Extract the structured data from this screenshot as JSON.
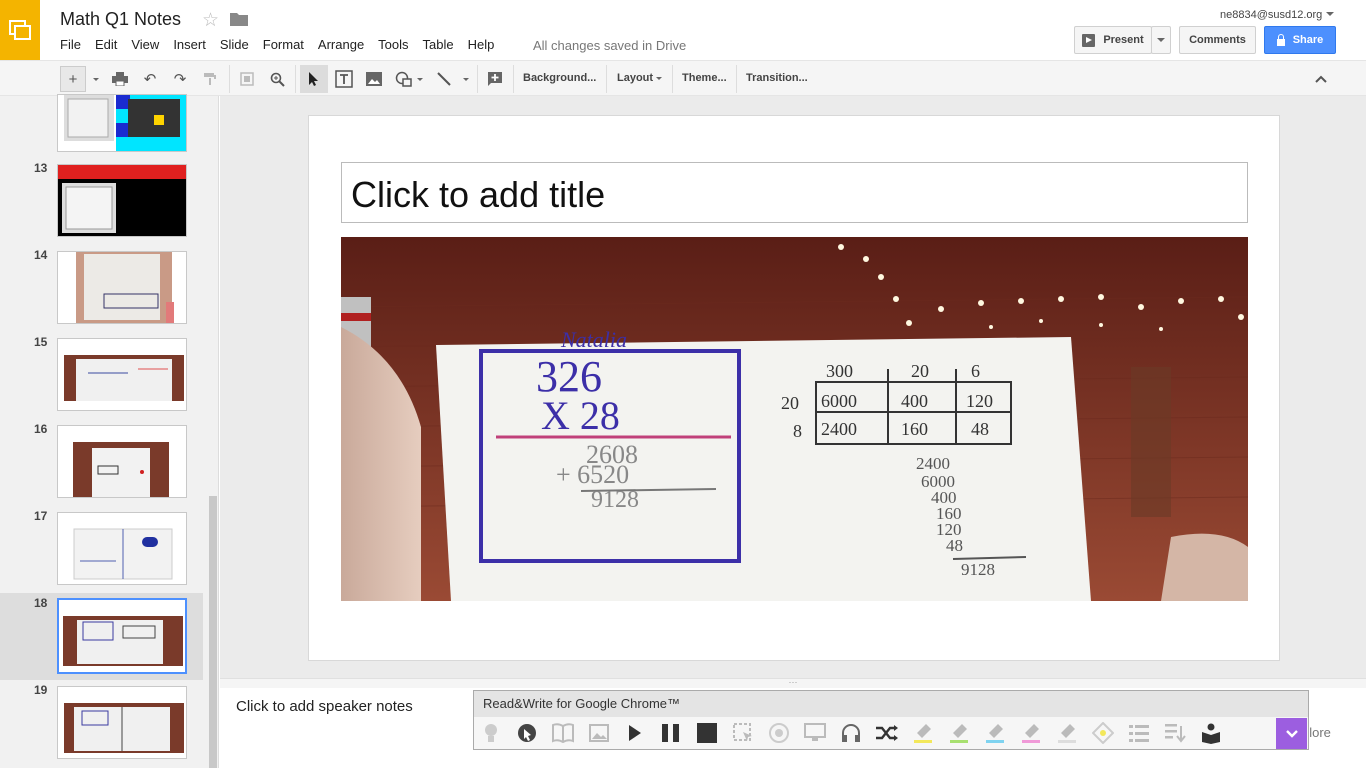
{
  "app": {
    "doc_title": "Math Q1 Notes",
    "save_status": "All changes saved in Drive",
    "account": "ne8834@susd12.org"
  },
  "menu": [
    "File",
    "Edit",
    "View",
    "Insert",
    "Slide",
    "Format",
    "Arrange",
    "Tools",
    "Table",
    "Help"
  ],
  "buttons": {
    "present": "Present",
    "comments": "Comments",
    "share": "Share"
  },
  "toolbar": {
    "background": "Background...",
    "layout": "Layout",
    "theme": "Theme...",
    "transition": "Transition..."
  },
  "filmstrip": {
    "slides": [
      {
        "num": "",
        "thumb": "collage-icon"
      },
      {
        "num": "13",
        "thumb": "red-banner-board"
      },
      {
        "num": "14",
        "thumb": "paper-held"
      },
      {
        "num": "15",
        "thumb": "whiteboard-photo"
      },
      {
        "num": "16",
        "thumb": "paper-held"
      },
      {
        "num": "17",
        "thumb": "worksheet"
      },
      {
        "num": "18",
        "thumb": "whiteboard-photo",
        "selected": true
      },
      {
        "num": "19",
        "thumb": "whiteboard-photo"
      }
    ]
  },
  "slide": {
    "title_placeholder": "Click to add title",
    "photo": {
      "name_text": "Natalia",
      "problem_top": "326",
      "problem_bottom": "X 28",
      "partial_1": "2608",
      "partial_2": "+ 6520",
      "result": "9128",
      "area_model": {
        "cols": [
          "300",
          "20",
          "6"
        ],
        "rows": [
          {
            "label": "20",
            "cells": [
              "6000",
              "400",
              "120"
            ]
          },
          {
            "label": "8",
            "cells": [
              "2400",
              "160",
              "48"
            ]
          }
        ]
      },
      "sum_column": [
        "2400",
        "6000",
        "400",
        "160",
        "120",
        "48",
        "9128"
      ]
    }
  },
  "notes": {
    "placeholder": "Click to add speaker notes",
    "explore_label": "plore"
  },
  "readwrite": {
    "title": "Read&Write for Google Chrome™",
    "tools": [
      "prediction-icon",
      "talk-and-type-icon",
      "dictionary-icon",
      "picture-dictionary-icon",
      "play-icon",
      "pause-icon",
      "stop-icon",
      "screenshot-reader-icon",
      "audio-maker-icon",
      "web-search-icon",
      "speech-input-icon",
      "simplify-icon",
      "highlight-yellow-icon",
      "highlight-green-icon",
      "highlight-blue-icon",
      "highlight-pink-icon",
      "clear-highlights-icon",
      "collect-highlights-icon",
      "vocabulary-list-icon",
      "voice-note-icon",
      "practice-reading-icon"
    ],
    "colors": {
      "accent": "#9c5ee0",
      "yellow": "#f3e85b",
      "green": "#a8e070",
      "blue": "#7fd3f0",
      "pink": "#f09ad8"
    }
  },
  "colors": {
    "brand_yellow": "#f4b400",
    "share_blue": "#4d90fe",
    "selected_border": "#4d90fe"
  }
}
